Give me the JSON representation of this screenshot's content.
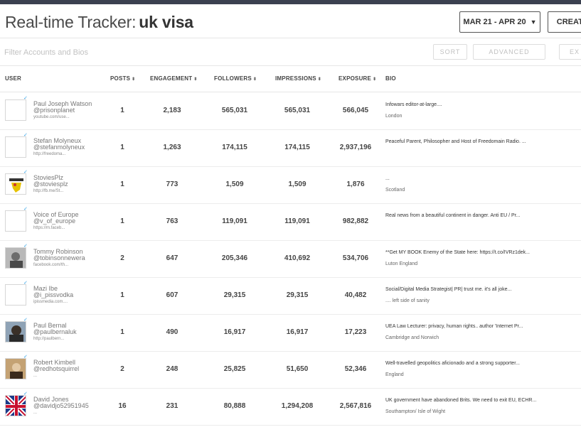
{
  "header": {
    "title_prefix": "Real-time Tracker:",
    "query": "uk visa",
    "date_range": "MAR 21 - APR 20",
    "create_label": "CREATE"
  },
  "filter": {
    "placeholder": "Filter Accounts and Bios",
    "sort_label": "SORT",
    "advanced_label": "ADVANCED",
    "export_label": "EX"
  },
  "columns": {
    "user": "USER",
    "posts": "POSTS",
    "engagement": "ENGAGEMENT",
    "followers": "FOLLOWERS",
    "impressions": "IMPRESSIONS",
    "exposure": "EXPOSURE",
    "bio": "BIO"
  },
  "rows": [
    {
      "name": "Paul Joseph Watson",
      "handle": "@prisonplanet",
      "link": "youtube.com/use...",
      "posts": "1",
      "engagement": "2,183",
      "followers": "565,031",
      "impressions": "565,031",
      "exposure": "566,045",
      "bio": "Infowars editor-at-large....",
      "location": "London",
      "avatar": "blank"
    },
    {
      "name": "Stefan Molyneux",
      "handle": "@stefanmolyneux",
      "link": "http://freedoma...",
      "posts": "1",
      "engagement": "1,263",
      "followers": "174,115",
      "impressions": "174,115",
      "exposure": "2,937,196",
      "bio": "Peaceful Parent, Philosopher and Host of Freedomain Radio. ...",
      "location": "",
      "avatar": "blank"
    },
    {
      "name": "StoviesPlz",
      "handle": "@stoviesplz",
      "link": "http://fb.me/St...",
      "posts": "1",
      "engagement": "773",
      "followers": "1,509",
      "impressions": "1,509",
      "exposure": "1,876",
      "bio": "...",
      "location": "Scotland",
      "avatar": "lion"
    },
    {
      "name": "Voice of Europe",
      "handle": "@v_of_europe",
      "link": "https://m.faceb...",
      "posts": "1",
      "engagement": "763",
      "followers": "119,091",
      "impressions": "119,091",
      "exposure": "982,882",
      "bio": "Real news from a beautiful continent in danger. Anti EU / Pr...",
      "location": "",
      "avatar": "blank"
    },
    {
      "name": "Tommy Robinson",
      "handle": "@tobinsonnewera",
      "link": "facebook.com/th...",
      "posts": "2",
      "engagement": "647",
      "followers": "205,346",
      "impressions": "410,692",
      "exposure": "534,706",
      "bio": "**Get MY BOOK Enemy of the State here: https://t.co/IVRz1dek...",
      "location": "Luton England",
      "avatar": "photo-gray"
    },
    {
      "name": "Mazi Ibe",
      "handle": "@i_pissvodka",
      "link": "ipissmedia.com....",
      "posts": "1",
      "engagement": "607",
      "followers": "29,315",
      "impressions": "29,315",
      "exposure": "40,482",
      "bio": "Social/Digital Media Strategist| PR| trust me. it's all joke...",
      "location": ".... left side of sanity",
      "avatar": "blank"
    },
    {
      "name": "Paul Bernal",
      "handle": "@paulbernaluk",
      "link": "http://paulbern...",
      "posts": "1",
      "engagement": "490",
      "followers": "16,917",
      "impressions": "16,917",
      "exposure": "17,223",
      "bio": "UEA Law Lecturer: privacy, human rights.. author 'Internet Pr...",
      "location": "Cambridge and Norwich",
      "avatar": "photo-dark"
    },
    {
      "name": "Robert Kimbell",
      "handle": "@redhotsquirrel",
      "link": "...",
      "posts": "2",
      "engagement": "248",
      "followers": "25,825",
      "impressions": "51,650",
      "exposure": "52,346",
      "bio": "Well-travelled geopolitics aficionado and a strong supporter...",
      "location": "England",
      "avatar": "photo-brown"
    },
    {
      "name": "David Jones",
      "handle": "@davidjo52951945",
      "link": "...",
      "posts": "16",
      "engagement": "231",
      "followers": "80,888",
      "impressions": "1,294,208",
      "exposure": "2,567,816",
      "bio": "UK government have abandoned Brits. We need to exit EU, ECHR...",
      "location": "Southampton/ Isle of Wight",
      "avatar": "union-jack"
    }
  ]
}
